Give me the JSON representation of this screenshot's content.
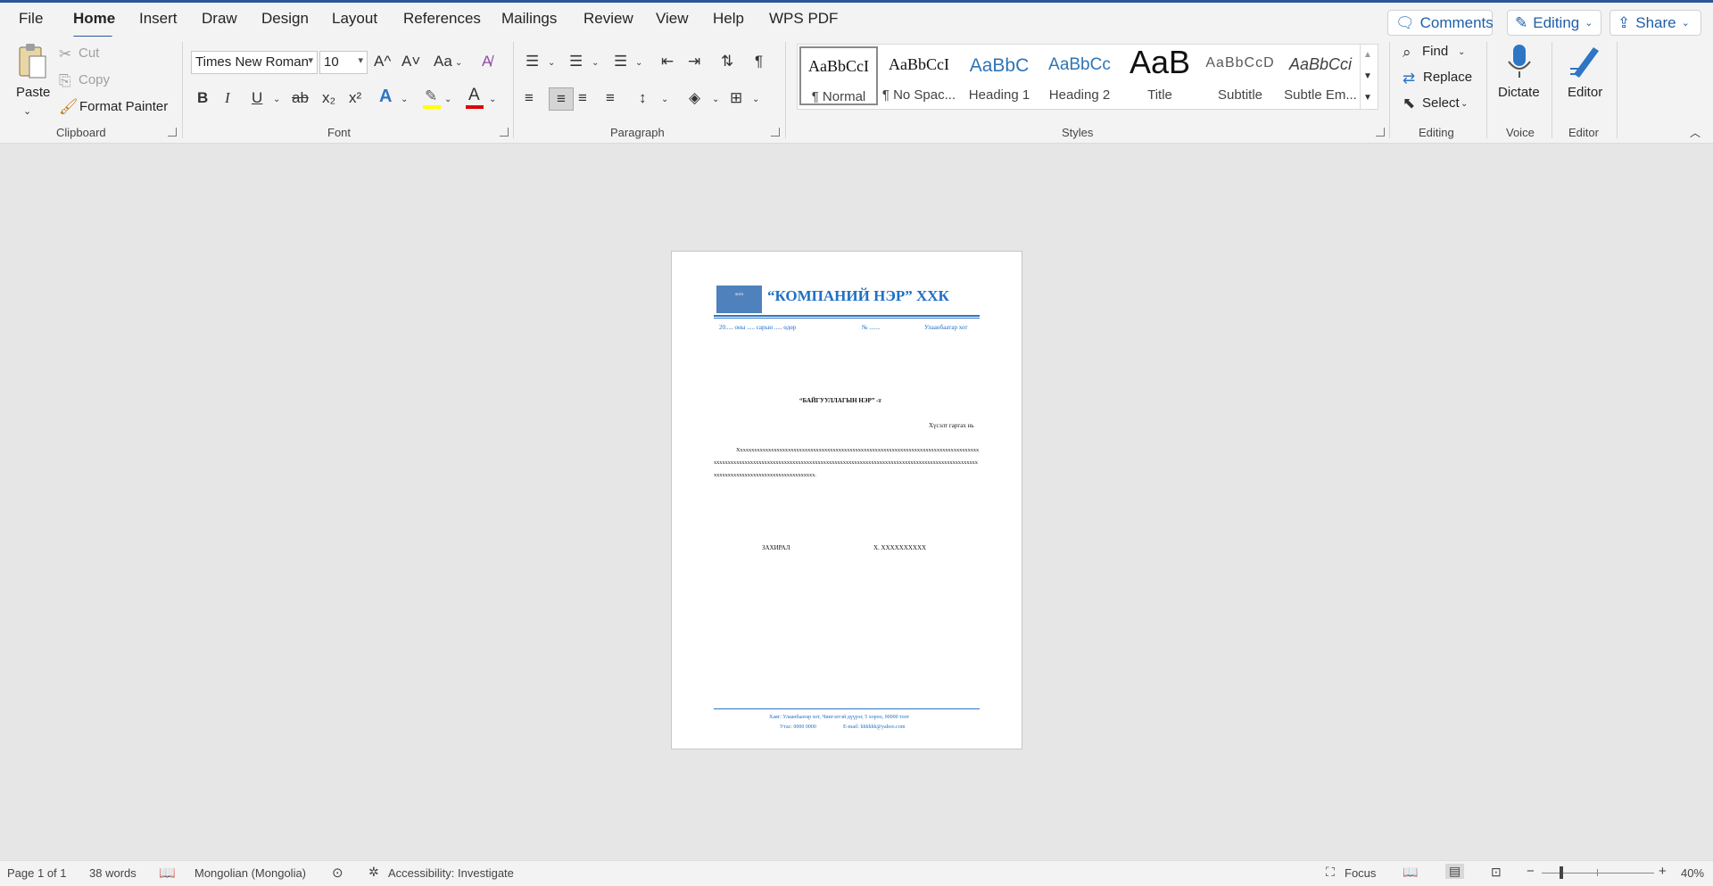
{
  "menu": {
    "tabs": [
      "File",
      "Home",
      "Insert",
      "Draw",
      "Design",
      "Layout",
      "References",
      "Mailings",
      "Review",
      "View",
      "Help",
      "WPS PDF"
    ],
    "comments": "Comments",
    "editing": "Editing",
    "share": "Share"
  },
  "ribbon": {
    "clipboard": {
      "paste": "Paste",
      "cut": "Cut",
      "copy": "Copy",
      "format_painter": "Format Painter",
      "label": "Clipboard"
    },
    "font": {
      "name": "Times New Roman",
      "size": "10",
      "label": "Font",
      "grow": "A^",
      "shrink": "A˅",
      "case": "Aa",
      "bold": "B",
      "italic": "I",
      "underline": "U",
      "strike": "ab",
      "sub": "x₂",
      "sup": "x²"
    },
    "paragraph": {
      "label": "Paragraph"
    },
    "styles": {
      "label": "Styles",
      "items": [
        {
          "preview": "AaBbCcI",
          "name": "¶ Normal"
        },
        {
          "preview": "AaBbCcI",
          "name": "¶ No Spac..."
        },
        {
          "preview": "AaBbC",
          "name": "Heading 1"
        },
        {
          "preview": "AaBbCc",
          "name": "Heading 2"
        },
        {
          "preview": "AaB",
          "name": "Title"
        },
        {
          "preview": "AaBbCcD",
          "name": "Subtitle"
        },
        {
          "preview": "AaBbCci",
          "name": "Subtle Em..."
        }
      ]
    },
    "editing": {
      "find": "Find",
      "replace": "Replace",
      "select": "Select",
      "label": "Editing"
    },
    "voice": {
      "dictate": "Dictate",
      "label": "Voice"
    },
    "editor": {
      "editor": "Editor",
      "label": "Editor"
    }
  },
  "document": {
    "logo_text": "лого",
    "company": "“КОМПАНИЙ НЭР” ХХК",
    "date_line": "20..... оны ..... сарын ..... өдөр",
    "number_line": "№ .......",
    "city": "Улаанбаатар хот",
    "recipient": "“БАЙГУУЛЛАГЫН НЭР” -т",
    "subject": "Хүсэлт гаргах нь",
    "body": "Xxxxxxxxxxxxxxxxxxxxxxxxxxxxxxxxxxxxxxxxxxxxxxxxxxxxxxxxxxxxxxxxxxxxxxxxxxxxxxxxxxxxxxxxxxxxxxxxxxxxxxxxxxxxxxxxxxxxxxxxxxxxxxxxxxxxxxxxxxxxxxxxxxxxxxxxxxxxxxxxxxxxxxxxxxxxxxxxxxxxxxxxxxxxxxxxxxxxxxxxxxxxxxxxxxxxxxxx.",
    "director_title": "ЗАХИРАЛ",
    "director_name": "Х. XXXXXXXXXX",
    "address": "Хаяг: Улаанбаатар хот, Чингэлтэй дүүрэг, 5 хороо, 00000 тоот",
    "phone": "Утас: 0000 0000",
    "email": "Е-mail: hhhhhh@yahoo.com"
  },
  "status": {
    "page": "Page 1 of 1",
    "words": "38 words",
    "language": "Mongolian (Mongolia)",
    "accessibility": "Accessibility: Investigate",
    "focus": "Focus",
    "zoom": "40%"
  },
  "colors": {
    "accent": "#2b579a",
    "company_blue": "#1f6fc6",
    "logo_fill": "#4f81bd"
  }
}
